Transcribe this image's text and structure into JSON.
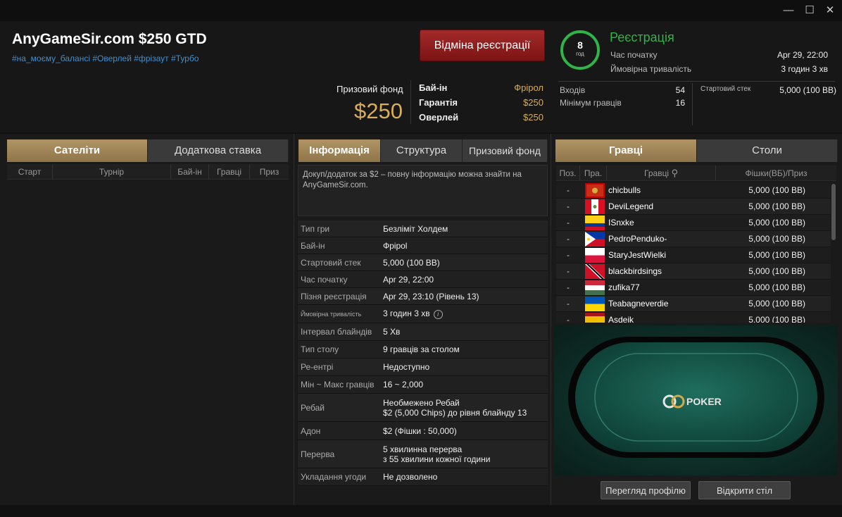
{
  "window": {
    "minimize": "—",
    "maximize": "☐",
    "close": "✕"
  },
  "header": {
    "title": "AnyGameSir.com $250 GTD",
    "tags": "#на_моєму_балансі #Оверлей #фрізаут #Турбо",
    "cancel_button": "Відміна реєстрації",
    "prize_fund_label": "Призовий фонд",
    "prize_fund_value": "$250",
    "buyin_rows": [
      {
        "label": "Бай-ін",
        "value": "Фрірол"
      },
      {
        "label": "Гарантія",
        "value": "$250"
      },
      {
        "label": "Оверлей",
        "value": "$250"
      }
    ],
    "registration": {
      "ring_number": "8",
      "ring_unit": "год",
      "status": "Реєстрація",
      "start_label": "Час початку",
      "start_value": "Apr 29, 22:00",
      "duration_label": "Ймовірна тривалість",
      "duration_value": "3 годин 3 хв",
      "entries_label": "Входів",
      "entries_value": "54",
      "min_players_label": "Мінімум гравців",
      "min_players_value": "16",
      "start_stack_label": "Стартовий стек",
      "start_stack_value": "5,000 (100 BB)"
    }
  },
  "left": {
    "tabs": [
      "Сателіти",
      "Додаткова ставка"
    ],
    "columns": [
      "Старт",
      "Турнір",
      "Бай-ін",
      "Гравці",
      "Приз"
    ]
  },
  "middle": {
    "tabs": [
      "Інформація",
      "Структура",
      "Призовий фонд"
    ],
    "note": "Докуп/додаток за $2 – повну інформацію можна знайти на AnyGameSir.com.",
    "rows": [
      {
        "k": "Тип гри",
        "v": "Безліміт Холдем"
      },
      {
        "k": "Бай-ін",
        "v": "Фріроl"
      },
      {
        "k": "Стартовий стек",
        "v": "5,000 (100 BB)"
      },
      {
        "k": "Час початку",
        "v": "Apr 29, 22:00"
      },
      {
        "k": "Пізня реєстрація",
        "v": "Apr 29, 23:10 (Рівень 13)"
      },
      {
        "k": "Ймовірна тривалість",
        "v": "3 годин 3 хв"
      },
      {
        "k": "Інтервал блайндів",
        "v": "5 Хв"
      },
      {
        "k": "Тип столу",
        "v": "9 гравців за столом"
      },
      {
        "k": "Ре-ентрі",
        "v": "Недоступно"
      },
      {
        "k": "Мін ~ Макс гравців",
        "v": "16 ~ 2,000"
      },
      {
        "k": "Ребай",
        "v": "Необмежено Ребай",
        "v2": "$2 (5,000 Chips) до рівня блайнду 13"
      },
      {
        "k": "Адон",
        "v": "$2 (Фішки : 50,000)"
      },
      {
        "k": "Перерва",
        "v": "5 хвилинна перерва",
        "v2": "з 55 хвилини кожної години"
      },
      {
        "k": "Укладання угоди",
        "v": "Не дозволено"
      }
    ]
  },
  "right": {
    "tabs": [
      "Гравці",
      "Столи"
    ],
    "columns": [
      "Поз.",
      "Пра.",
      "Гравці",
      "Фішки(ВБ)/Приз"
    ],
    "players": [
      {
        "pos": "-",
        "flag": "ME",
        "name": "chicbulls",
        "chips": "5,000 (100 BB)"
      },
      {
        "pos": "-",
        "flag": "PE",
        "name": "DeviLegend",
        "chips": "5,000 (100 BB)"
      },
      {
        "pos": "-",
        "flag": "CO",
        "name": "ISnxke",
        "chips": "5,000 (100 BB)"
      },
      {
        "pos": "-",
        "flag": "PH",
        "name": "PedroPenduko-",
        "chips": "5,000 (100 BB)"
      },
      {
        "pos": "-",
        "flag": "PL",
        "name": "StaryJestWielki",
        "chips": "5,000 (100 BB)"
      },
      {
        "pos": "-",
        "flag": "TT",
        "name": "blackbirdsings",
        "chips": "5,000 (100 BB)"
      },
      {
        "pos": "-",
        "flag": "HU",
        "name": "zufika77",
        "chips": "5,000 (100 BB)"
      },
      {
        "pos": "-",
        "flag": "UA",
        "name": "Teabagneverdie",
        "chips": "5,000 (100 BB)"
      },
      {
        "pos": "-",
        "flag": "ES",
        "name": "Asdeik",
        "chips": "5,000 (100 BB)"
      }
    ],
    "table_logo": "POKER",
    "profile_button": "Перегляд профілю",
    "open_table_button": "Відкрити стіл"
  },
  "colors": {
    "gold": "#d9ad5c",
    "green": "#2eb447",
    "red": "#a32a2a",
    "tab_active": "#b09466"
  }
}
